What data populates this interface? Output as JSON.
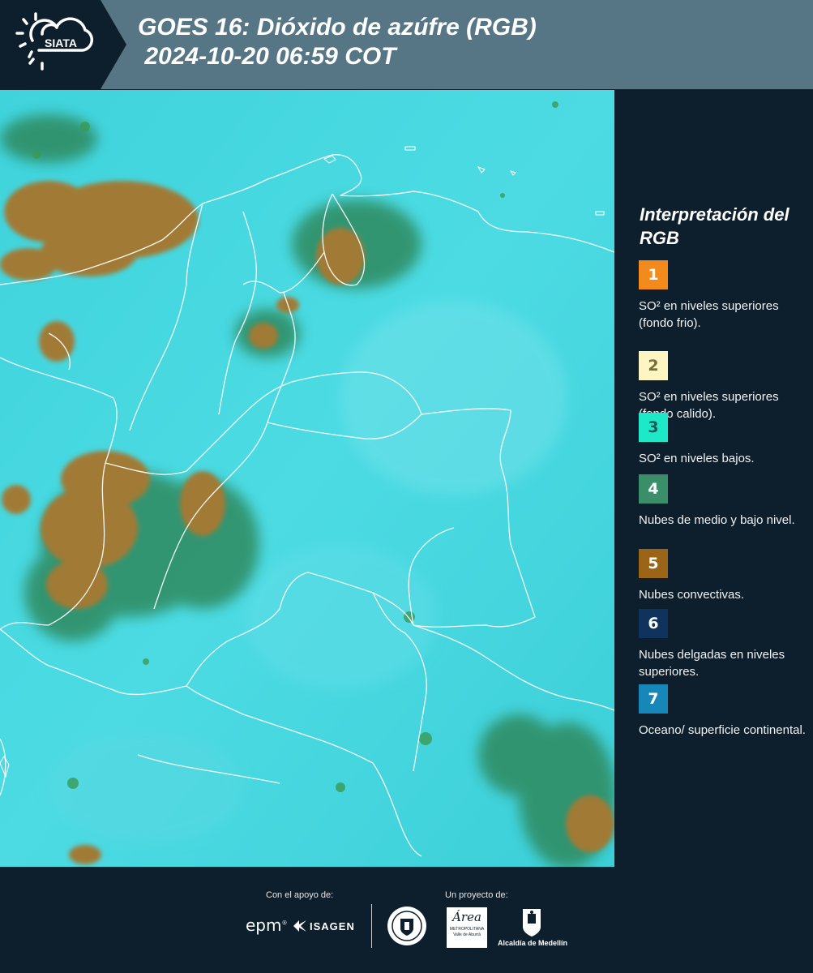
{
  "header": {
    "logo_text": "SIATA",
    "title_line1": "GOES 16: Dióxido de azúfre (RGB)",
    "title_line2": " 2024-10-20 06:59 COT",
    "background_color": "#567685"
  },
  "map": {
    "region": "Colombia y norte de Suramérica",
    "product": "SO2 RGB",
    "dominant_colors": {
      "surface": "#3ad4dc",
      "convective_clouds": "#a17a36",
      "mid_low_clouds": "#3b7e56"
    }
  },
  "legend": {
    "title": "Interpretación del RGB",
    "items": [
      {
        "number": "1",
        "color": "#f28a1c",
        "text_color": "#ffffff",
        "label": "SO² en niveles superiores (fondo frio)."
      },
      {
        "number": "2",
        "color": "#fdf6c3",
        "text_color": "#7a6a3a",
        "label": "SO² en niveles superiores (fondo calido)."
      },
      {
        "number": "3",
        "color": "#1de9c9",
        "text_color": "#1a5a55",
        "label": "SO² en niveles bajos."
      },
      {
        "number": "4",
        "color": "#3a8f6a",
        "text_color": "#ffffff",
        "label": "Nubes de medio y bajo nivel."
      },
      {
        "number": "5",
        "color": "#9a6516",
        "text_color": "#ffffff",
        "label": "Nubes convectivas."
      },
      {
        "number": "6",
        "color": "#10335e",
        "text_color": "#ffffff",
        "label": "Nubes delgadas en niveles superiores."
      },
      {
        "number": "7",
        "color": "#1687b8",
        "text_color": "#ffffff",
        "label": "Oceano/ superficie continental."
      }
    ]
  },
  "footer": {
    "support_label": "Con el apoyo de:",
    "project_label": "Un proyecto de:",
    "logos": {
      "epm": "epm",
      "isagen": "ISAGEN",
      "area_script": "Área",
      "area_name": "METROPOLITANA",
      "area_sub": "Valle de Aburrá",
      "alcaldia": "Alcaldía de Medellín"
    }
  }
}
